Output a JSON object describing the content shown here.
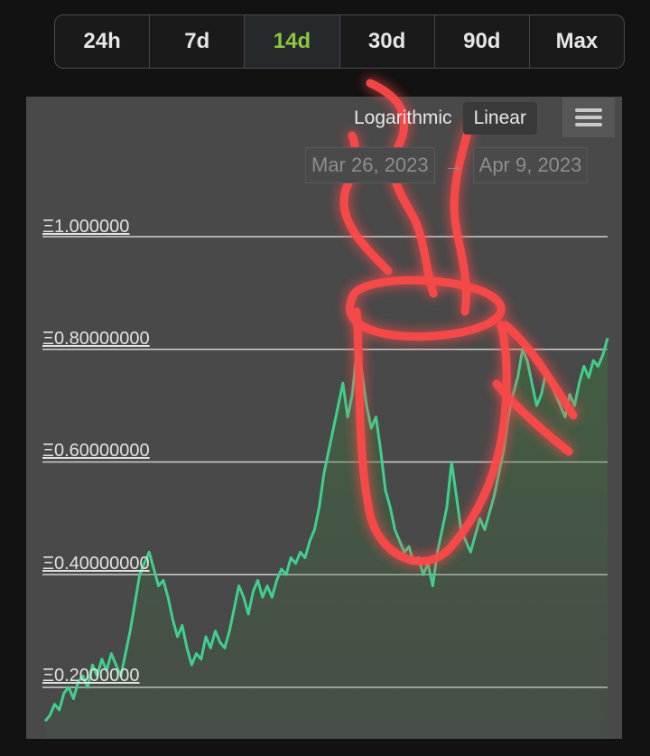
{
  "range_buttons": [
    "24h",
    "7d",
    "14d",
    "30d",
    "90d",
    "Max"
  ],
  "active_range": "14d",
  "scale_toggle": {
    "log_label": "Logarithmic",
    "linear_label": "Linear",
    "active": "Linear"
  },
  "menu_icon": "hamburger-menu-icon",
  "date_range": {
    "from": "Mar 26, 2023",
    "sep": "→",
    "to": "Apr 9, 2023"
  },
  "colors": {
    "line": "#3fd08e",
    "active_range": "#8dc63f",
    "panel": "#494949",
    "overlay": "#ff4a4a"
  },
  "chart_data": {
    "type": "area",
    "currency_symbol": "Ξ",
    "y_ticks": [
      "Ξ0.2000000",
      "Ξ0.40000000",
      "Ξ0.60000000",
      "Ξ0.80000000",
      "Ξ1.000000"
    ],
    "y_tick_values": [
      0.2,
      0.4,
      0.6,
      0.8,
      1.0
    ],
    "ylim": [
      0.1,
      1.05
    ],
    "grid": true,
    "scale": "linear",
    "values": [
      0.14,
      0.15,
      0.17,
      0.16,
      0.19,
      0.2,
      0.18,
      0.21,
      0.22,
      0.2,
      0.24,
      0.22,
      0.25,
      0.23,
      0.26,
      0.24,
      0.22,
      0.26,
      0.3,
      0.35,
      0.4,
      0.42,
      0.44,
      0.41,
      0.38,
      0.39,
      0.36,
      0.32,
      0.29,
      0.31,
      0.27,
      0.24,
      0.26,
      0.25,
      0.29,
      0.27,
      0.3,
      0.28,
      0.27,
      0.3,
      0.34,
      0.38,
      0.36,
      0.33,
      0.37,
      0.39,
      0.36,
      0.38,
      0.36,
      0.39,
      0.41,
      0.4,
      0.43,
      0.42,
      0.44,
      0.43,
      0.46,
      0.48,
      0.52,
      0.58,
      0.62,
      0.66,
      0.7,
      0.74,
      0.68,
      0.72,
      0.8,
      0.76,
      0.7,
      0.66,
      0.68,
      0.62,
      0.55,
      0.52,
      0.48,
      0.46,
      0.44,
      0.45,
      0.42,
      0.43,
      0.4,
      0.42,
      0.38,
      0.44,
      0.48,
      0.52,
      0.6,
      0.54,
      0.48,
      0.46,
      0.44,
      0.47,
      0.5,
      0.48,
      0.51,
      0.54,
      0.58,
      0.62,
      0.68,
      0.72,
      0.75,
      0.8,
      0.78,
      0.74,
      0.7,
      0.72,
      0.76,
      0.74,
      0.72,
      0.7,
      0.68,
      0.72,
      0.7,
      0.74,
      0.77,
      0.75,
      0.78,
      0.77,
      0.79,
      0.82
    ]
  },
  "overlay_drawing": "steaming-cup-doodle"
}
